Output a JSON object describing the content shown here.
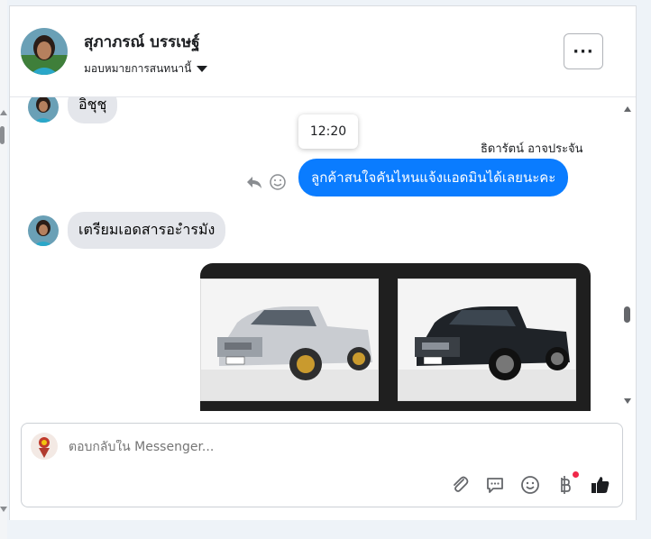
{
  "header": {
    "name": "สุภาภรณ์ บรรเษฐ์",
    "assign_label": "มอบหมายการสนทนานี้",
    "more_label": "···"
  },
  "messages": [
    {
      "from": "customer",
      "text": "อิชุชุ"
    },
    {
      "from": "page",
      "time_tooltip": "12:20",
      "sender": "ธิดารัตน์ อาจประจัน",
      "text": "ลูกค้าสนใจคันไหนแจ้งแอดมินได้เลยนะคะ"
    },
    {
      "from": "customer",
      "text": "เตรียมเอดสารอะำรมัง"
    }
  ],
  "composer": {
    "placeholder": "ตอบกลับใน Messenger..."
  },
  "icons": {
    "reply": "reply-icon",
    "react": "smiley-react-icon",
    "attach": "paperclip-icon",
    "saved_reply": "chat-bubble-icon",
    "emoji": "emoji-icon",
    "payment": "baht-icon",
    "like": "thumbs-up-icon"
  },
  "colors": {
    "accent": "#0a7cff",
    "incoming_bubble": "#e4e6eb",
    "notification_dot": "#f02849"
  }
}
